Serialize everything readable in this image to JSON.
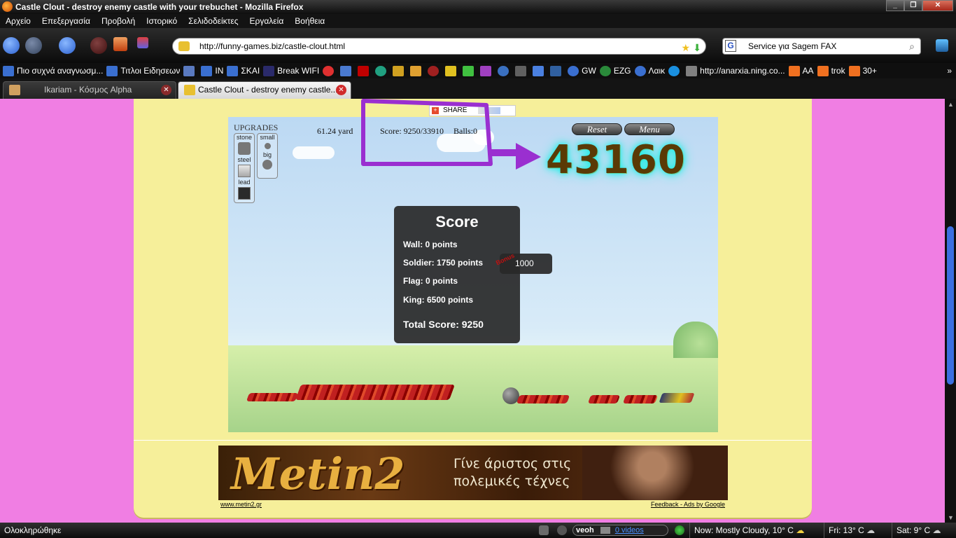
{
  "window": {
    "title": "Castle Clout - destroy enemy castle with your trebuchet - Mozilla Firefox"
  },
  "menu": [
    "Αρχείο",
    "Επεξεργασία",
    "Προβολή",
    "Ιστορικό",
    "Σελιδοδείκτες",
    "Εργαλεία",
    "Βοήθεια"
  ],
  "nav": {
    "url": "http://funny-games.biz/castle-clout.html",
    "search_value": "Service για Sagem FAX"
  },
  "bookmarks": [
    "Πιο συχνά αναγνωσμ...",
    "Τιτλοι Ειδησεων",
    "IN",
    "ΣΚΑΙ",
    "Break WIFI",
    "GW",
    "EZG",
    "Λαικ",
    "http://anarxia.ning.co...",
    "AA",
    "trok",
    "30+"
  ],
  "tabs": [
    {
      "label": "Ikariam - Κόσμος Alpha"
    },
    {
      "label": "Castle Clout - destroy enemy castle..."
    }
  ],
  "share": {
    "label": "SHARE"
  },
  "game": {
    "upgrades_title": "UPGRADES",
    "ammo": [
      "stone",
      "steel",
      "lead"
    ],
    "sizes": [
      "small",
      "big"
    ],
    "distance": "61.24 yard",
    "score": "Score: 9250/33910",
    "balls": "Balls:0",
    "reset_label": "Reset",
    "menu_label": "Menu",
    "annotation_score": "43160",
    "panel": {
      "title": "Score",
      "wall": "Wall: 0 points",
      "soldier": "Soldier: 1750 points",
      "flag": "Flag: 0 points",
      "king": "King: 6500 points",
      "total": "Total Score: 9250"
    },
    "bonus": {
      "label": "Bonus",
      "value": "1000"
    }
  },
  "ad": {
    "logo": "Metin2",
    "line1": "Γίνε άριστος στις",
    "line2": "πολεμικές τέχνες",
    "link_left": "www.metin2.gr",
    "link_right": "Feedback - Ads by Google"
  },
  "status": {
    "text": "Ολοκληρώθηκε",
    "veoh": "veoh",
    "veoh_videos": "0 videos",
    "weather_now": "Now: Mostly Cloudy, 10° C",
    "weather_fri": "Fri: 13° C",
    "weather_sat": "Sat: 9° C"
  },
  "colors": {
    "page_bg": "#f07ee3",
    "content_bg": "#f6ef9a",
    "annotation": "#9a2fd0",
    "glow": "#1df0e6"
  }
}
